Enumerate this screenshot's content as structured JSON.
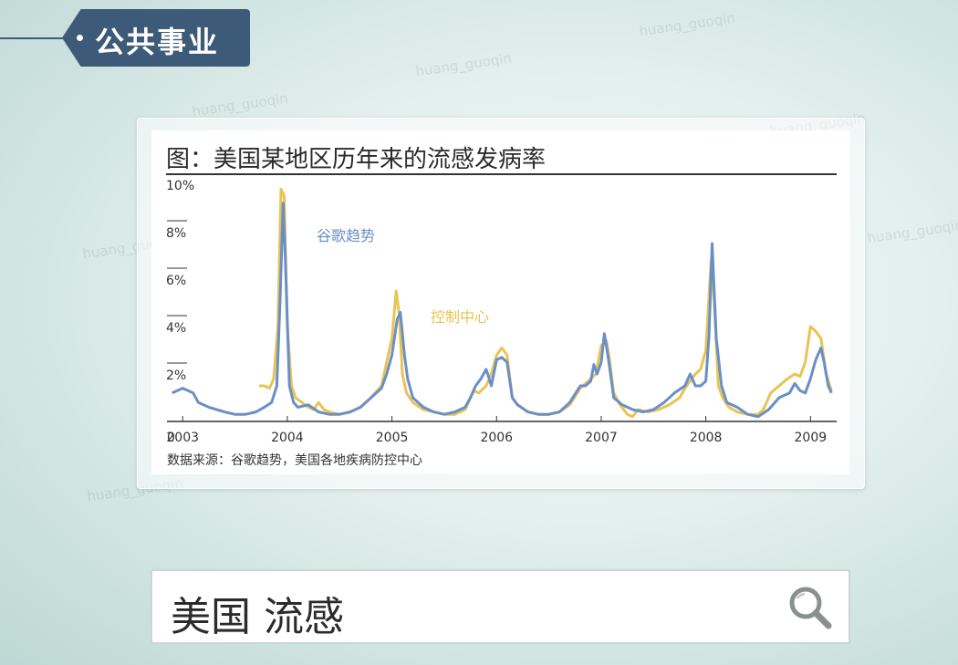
{
  "badge": {
    "label": "公共事业"
  },
  "watermark": "huang_guoqin",
  "chart_data": {
    "type": "line",
    "title": "图：美国某地区历年来的流感发病率",
    "source": "数据来源：谷歌趋势，美国各地疾病防控中心",
    "y_ticks": [
      "0",
      "2%",
      "4%",
      "6%",
      "8%",
      "10%"
    ],
    "ylim": [
      0,
      10
    ],
    "xlim": [
      2002.85,
      2009.25
    ],
    "x_ticks": [
      "2003",
      "2004",
      "2005",
      "2006",
      "2007",
      "2008",
      "2009"
    ],
    "grid": false,
    "series": [
      {
        "name": "谷歌趋势",
        "color": "#6a8fc7",
        "x": [
          2002.9,
          2003.0,
          2003.1,
          2003.15,
          2003.25,
          2003.4,
          2003.5,
          2003.6,
          2003.7,
          2003.78,
          2003.85,
          2003.9,
          2003.93,
          2003.96,
          2003.98,
          2004.02,
          2004.06,
          2004.1,
          2004.2,
          2004.3,
          2004.4,
          2004.5,
          2004.6,
          2004.7,
          2004.8,
          2004.9,
          2004.95,
          2005.0,
          2005.05,
          2005.08,
          2005.12,
          2005.15,
          2005.2,
          2005.3,
          2005.4,
          2005.5,
          2005.6,
          2005.7,
          2005.75,
          2005.8,
          2005.85,
          2005.9,
          2005.93,
          2005.95,
          2006.0,
          2006.05,
          2006.1,
          2006.15,
          2006.2,
          2006.3,
          2006.4,
          2006.5,
          2006.6,
          2006.7,
          2006.8,
          2006.85,
          2006.9,
          2006.93,
          2006.96,
          2007.0,
          2007.03,
          2007.07,
          2007.12,
          2007.2,
          2007.3,
          2007.4,
          2007.5,
          2007.6,
          2007.7,
          2007.8,
          2007.85,
          2007.9,
          2007.95,
          2008.0,
          2008.03,
          2008.06,
          2008.1,
          2008.15,
          2008.2,
          2008.3,
          2008.4,
          2008.5,
          2008.6,
          2008.7,
          2008.8,
          2008.85,
          2008.9,
          2008.95,
          2009.0,
          2009.05,
          2009.1,
          2009.13,
          2009.17,
          2009.2
        ],
        "y": [
          1.2,
          1.4,
          1.2,
          0.8,
          0.6,
          0.4,
          0.3,
          0.3,
          0.4,
          0.6,
          0.8,
          1.5,
          5.0,
          9.2,
          7.0,
          1.5,
          0.8,
          0.6,
          0.7,
          0.4,
          0.3,
          0.3,
          0.4,
          0.6,
          1.0,
          1.4,
          2.0,
          2.8,
          4.3,
          4.6,
          2.8,
          1.8,
          1.0,
          0.6,
          0.4,
          0.3,
          0.4,
          0.6,
          1.0,
          1.5,
          1.8,
          2.2,
          1.8,
          1.5,
          2.6,
          2.7,
          2.5,
          1.0,
          0.7,
          0.4,
          0.3,
          0.3,
          0.4,
          0.8,
          1.5,
          1.5,
          1.7,
          2.4,
          2.0,
          2.5,
          3.7,
          2.6,
          1.0,
          0.7,
          0.5,
          0.4,
          0.5,
          0.8,
          1.2,
          1.5,
          2.0,
          1.5,
          1.5,
          1.7,
          3.6,
          7.5,
          3.5,
          1.5,
          0.8,
          0.6,
          0.3,
          0.2,
          0.5,
          1.0,
          1.2,
          1.6,
          1.3,
          1.2,
          1.8,
          2.6,
          3.1,
          2.5,
          1.5,
          1.2
        ]
      },
      {
        "name": "控制中心",
        "color": "#e8c454",
        "x": [
          2003.73,
          2003.78,
          2003.83,
          2003.87,
          2003.91,
          2003.94,
          2003.97,
          2004.0,
          2004.04,
          2004.08,
          2004.2,
          2004.25,
          2004.3,
          2004.35,
          2004.4,
          2004.5,
          2004.6,
          2004.7,
          2004.8,
          2004.9,
          2004.95,
          2005.0,
          2005.04,
          2005.07,
          2005.1,
          2005.14,
          2005.2,
          2005.3,
          2005.4,
          2005.5,
          2005.6,
          2005.7,
          2005.78,
          2005.83,
          2005.9,
          2005.95,
          2006.0,
          2006.05,
          2006.1,
          2006.15,
          2006.2,
          2006.3,
          2006.4,
          2006.5,
          2006.6,
          2006.7,
          2006.8,
          2006.85,
          2006.9,
          2006.95,
          2007.0,
          2007.05,
          2007.08,
          2007.12,
          2007.18,
          2007.25,
          2007.3,
          2007.35,
          2007.45,
          2007.55,
          2007.65,
          2007.75,
          2007.8,
          2007.85,
          2007.9,
          2007.95,
          2008.0,
          2008.05,
          2008.08,
          2008.12,
          2008.16,
          2008.22,
          2008.3,
          2008.4,
          2008.5,
          2008.55,
          2008.62,
          2008.7,
          2008.78,
          2008.85,
          2008.9,
          2008.95,
          2009.0,
          2009.05,
          2009.1,
          2009.15,
          2009.2
        ],
        "y": [
          1.5,
          1.5,
          1.4,
          1.8,
          4.0,
          9.8,
          9.5,
          4.0,
          1.5,
          1.0,
          0.6,
          0.5,
          0.8,
          0.5,
          0.4,
          0.3,
          0.4,
          0.6,
          1.0,
          1.5,
          2.5,
          3.5,
          5.5,
          4.5,
          2.0,
          1.2,
          0.8,
          0.5,
          0.4,
          0.3,
          0.3,
          0.5,
          1.3,
          1.2,
          1.5,
          2.0,
          2.8,
          3.1,
          2.8,
          1.0,
          0.7,
          0.4,
          0.3,
          0.3,
          0.4,
          0.7,
          1.4,
          1.6,
          1.8,
          2.0,
          3.2,
          3.4,
          2.6,
          1.2,
          0.7,
          0.3,
          0.2,
          0.5,
          0.4,
          0.5,
          0.7,
          1.0,
          1.4,
          1.7,
          2.0,
          2.2,
          3.0,
          6.8,
          5.0,
          1.5,
          1.0,
          0.6,
          0.4,
          0.3,
          0.3,
          0.5,
          1.2,
          1.5,
          1.8,
          2.0,
          1.9,
          2.5,
          4.0,
          3.8,
          3.5,
          2.0,
          1.3
        ]
      }
    ]
  },
  "search": {
    "query": "美国 流感",
    "icon": "search-icon"
  }
}
